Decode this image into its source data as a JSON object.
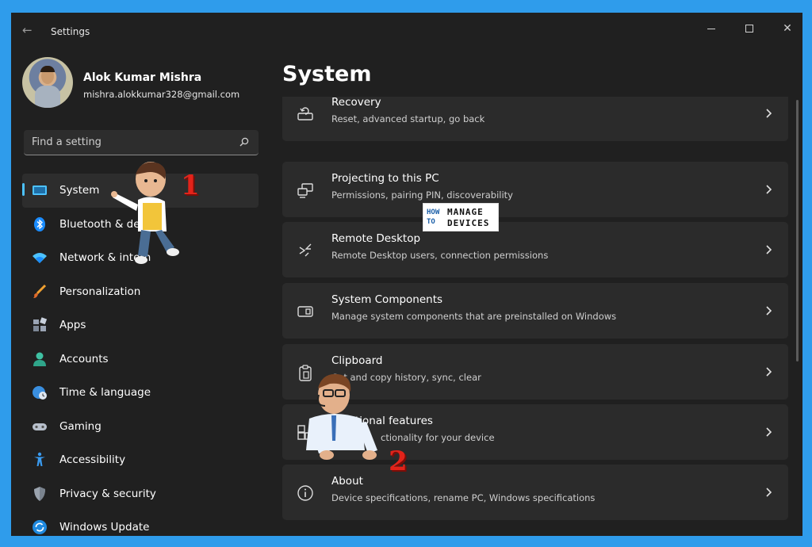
{
  "window": {
    "title": "Settings",
    "back_icon": "back-arrow-icon"
  },
  "profile": {
    "name": "Alok Kumar Mishra",
    "email": "mishra.alokkumar328@gmail.com"
  },
  "search": {
    "placeholder": "Find a setting",
    "icon": "search-icon"
  },
  "nav": {
    "items": [
      {
        "label": "System",
        "icon": "system-icon",
        "active": true
      },
      {
        "label": "Bluetooth & de",
        "icon": "bluetooth-icon"
      },
      {
        "label": "Network & intern",
        "icon": "wifi-icon"
      },
      {
        "label": "Personalization",
        "icon": "brush-icon"
      },
      {
        "label": "Apps",
        "icon": "apps-icon"
      },
      {
        "label": "Accounts",
        "icon": "accounts-icon"
      },
      {
        "label": "Time & language",
        "icon": "globe-clock-icon"
      },
      {
        "label": "Gaming",
        "icon": "gamepad-icon"
      },
      {
        "label": "Accessibility",
        "icon": "accessibility-icon"
      },
      {
        "label": "Privacy & security",
        "icon": "shield-icon"
      },
      {
        "label": "Windows Update",
        "icon": "update-icon"
      }
    ]
  },
  "main": {
    "title": "System",
    "cards": [
      {
        "title": "Recovery",
        "subtitle": "Reset, advanced startup, go back",
        "icon": "recovery-icon"
      },
      {
        "title": "Projecting to this PC",
        "subtitle": "Permissions, pairing PIN, discoverability",
        "icon": "projecting-icon"
      },
      {
        "title": "Remote Desktop",
        "subtitle": "Remote Desktop users, connection permissions",
        "icon": "remote-desktop-icon"
      },
      {
        "title": "System Components",
        "subtitle": "Manage system components that are preinstalled on Windows",
        "icon": "system-components-icon"
      },
      {
        "title": "Clipboard",
        "subtitle": "Cut and copy history, sync, clear",
        "icon": "clipboard-icon"
      },
      {
        "title": "tional features",
        "subtitle": "ctionality for your device",
        "icon": "optional-features-icon"
      },
      {
        "title": "About",
        "subtitle": "Device specifications, rename PC, Windows specifications",
        "icon": "info-icon"
      }
    ]
  },
  "watermark": {
    "how": "HOW",
    "to": "TO",
    "manage": "MANAGE",
    "devices": "DEVICES"
  },
  "annotations": {
    "step1": "1",
    "step2": "2"
  },
  "colors": {
    "accent": "#4cc2ff",
    "background": "#202020",
    "card": "#2b2b2b",
    "annotation": "#e2231a"
  }
}
